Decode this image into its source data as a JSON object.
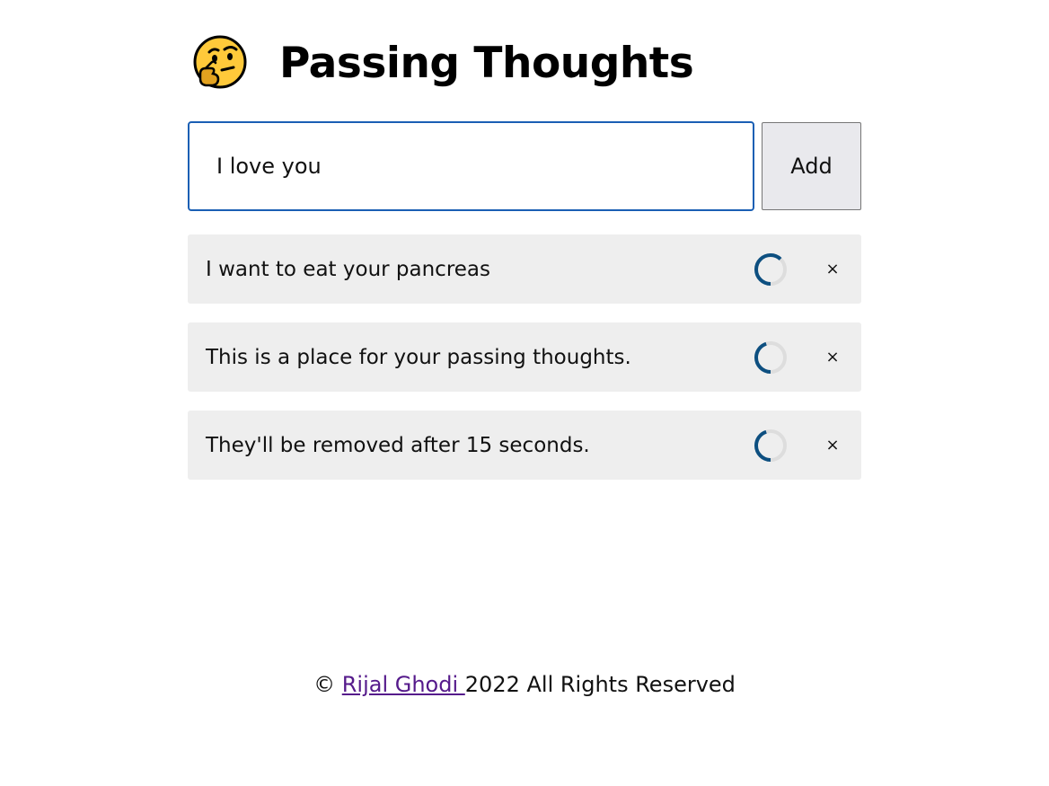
{
  "header": {
    "emoji": "thinking-face-icon",
    "title": "Passing Thoughts"
  },
  "form": {
    "input_value": "I love you",
    "add_label": "Add"
  },
  "thoughts": [
    {
      "text": "I want to eat your pancreas",
      "timer_progress": 0.62,
      "remove_label": "×"
    },
    {
      "text": "This is a place for your passing thoughts.",
      "timer_progress": 0.45,
      "remove_label": "×"
    },
    {
      "text": "They'll be removed after 15 seconds.",
      "timer_progress": 0.45,
      "remove_label": "×"
    }
  ],
  "footer": {
    "copyright_symbol": "©",
    "author_link": "Rijal Ghodi ",
    "rest": "2022 All Rights Reserved"
  },
  "colors": {
    "input_border": "#1a5fb4",
    "timer_fg": "#0d4f80",
    "timer_bg": "#dddddd",
    "thought_bg": "#eeeeee",
    "link": "#551a8b"
  }
}
